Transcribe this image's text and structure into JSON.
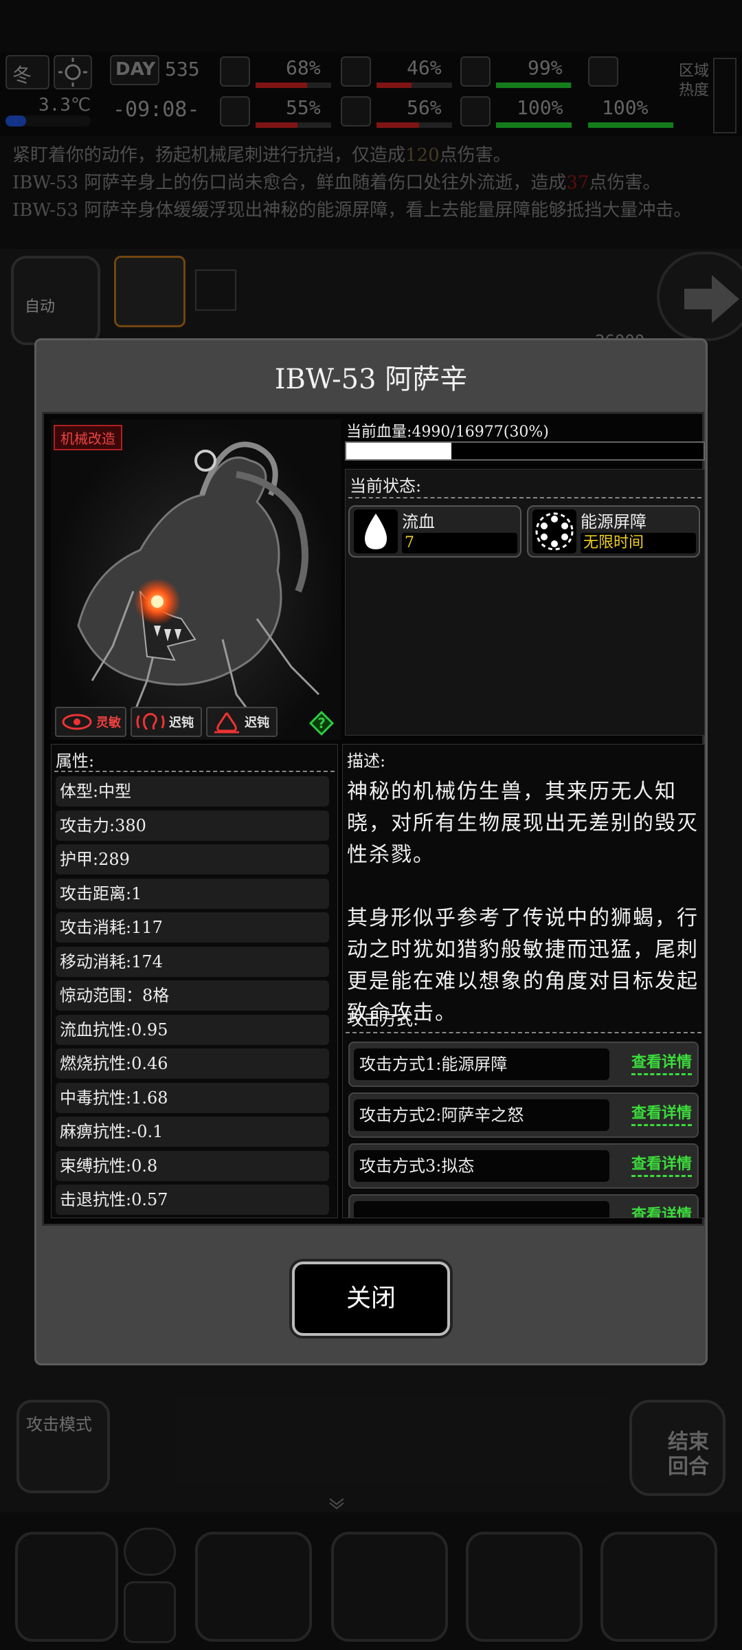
{
  "hud": {
    "season": "冬",
    "temperature": "3.3℃",
    "day_label": "DAY",
    "day": "535",
    "time": "-09:08-",
    "stats": [
      {
        "value": "68%",
        "level": 0.68,
        "trend": "down",
        "icon": "first-aid-icon"
      },
      {
        "value": "46%",
        "level": 0.46,
        "trend": "down",
        "icon": "stomach-icon"
      },
      {
        "value": "99%",
        "level": 0.99,
        "trend": "up",
        "icon": "sleep-icon"
      },
      {
        "value": "55%",
        "level": 0.55,
        "trend": "down",
        "icon": "brain-icon"
      },
      {
        "value": "56%",
        "level": 0.56,
        "trend": "down",
        "icon": "water-drop-icon"
      },
      {
        "value": "100%",
        "level": 1.0,
        "trend": "up",
        "icon": "heart-icon"
      },
      {
        "value": "100%",
        "level": 1.0,
        "trend": "up",
        "icon": "boot-icon"
      }
    ],
    "zone_heat_label": "区域热度"
  },
  "log": {
    "line1": "紧盯着你的动作，扬起机械尾刺进行抗挡，仅造成",
    "line1_num": "120",
    "line1_end": "点伤害。",
    "line2": "IBW-53 阿萨辛身上的伤口尚未愈合，鲜血随着伤口处往外流逝，造成",
    "line2_num": "37",
    "line2_end": "点伤害。",
    "line3": "IBW-53 阿萨辛身体缓缓浮现出神秘的能源屏障，看上去能量屏障能够抵挡大量冲击。"
  },
  "side_buttons": {
    "auto_label": "自动",
    "attack_mode_label": "攻击模式",
    "end_turn_label": "结束回合",
    "partial_number": "26000"
  },
  "modal": {
    "title": "IBW-53 阿萨辛",
    "tag": "机械改造",
    "traits": [
      {
        "label": "灵敏",
        "icon": "eye-icon"
      },
      {
        "label": "迟钝",
        "icon": "ear-icon"
      },
      {
        "label": "迟钝",
        "icon": "smell-icon"
      }
    ],
    "hp_label": "当前血量:4990/16977(30%)",
    "hp_fraction": 0.294,
    "status_label": "当前状态:",
    "statuses": [
      {
        "name": "流血",
        "value": "7",
        "icon": "blood-drop-icon"
      },
      {
        "name": "能源屏障",
        "value": "无限时间",
        "icon": "energy-shield-icon"
      }
    ],
    "attributes_title": "属性:",
    "attributes": [
      "体型:中型",
      "攻击力:380",
      "护甲:289",
      "攻击距离:1",
      "攻击消耗:117",
      "移动消耗:174",
      "惊动范围：8格",
      "流血抗性:0.95",
      "燃烧抗性:0.46",
      "中毒抗性:1.68",
      "麻痹抗性:-0.1",
      "束缚抗性:0.8",
      "击退抗性:0.57"
    ],
    "description_title": "描述:",
    "description": "神秘的机械仿生兽，其来历无人知晓，对所有生物展现出无差别的毁灭性杀戮。\n\n其身形似乎参考了传说中的狮蝎，行动之时犹如猎豹般敏捷而迅猛，尾刺更是能在难以想象的角度对目标发起致命攻击。",
    "attack_title": "攻击方式:",
    "attacks": [
      {
        "name": "攻击方式1:能源屏障",
        "button": "查看详情"
      },
      {
        "name": "攻击方式2:阿萨辛之怒",
        "button": "查看详情"
      },
      {
        "name": "攻击方式3:拟态",
        "button": "查看详情"
      },
      {
        "name": "",
        "button": "查看详情"
      }
    ],
    "close_label": "关闭"
  }
}
